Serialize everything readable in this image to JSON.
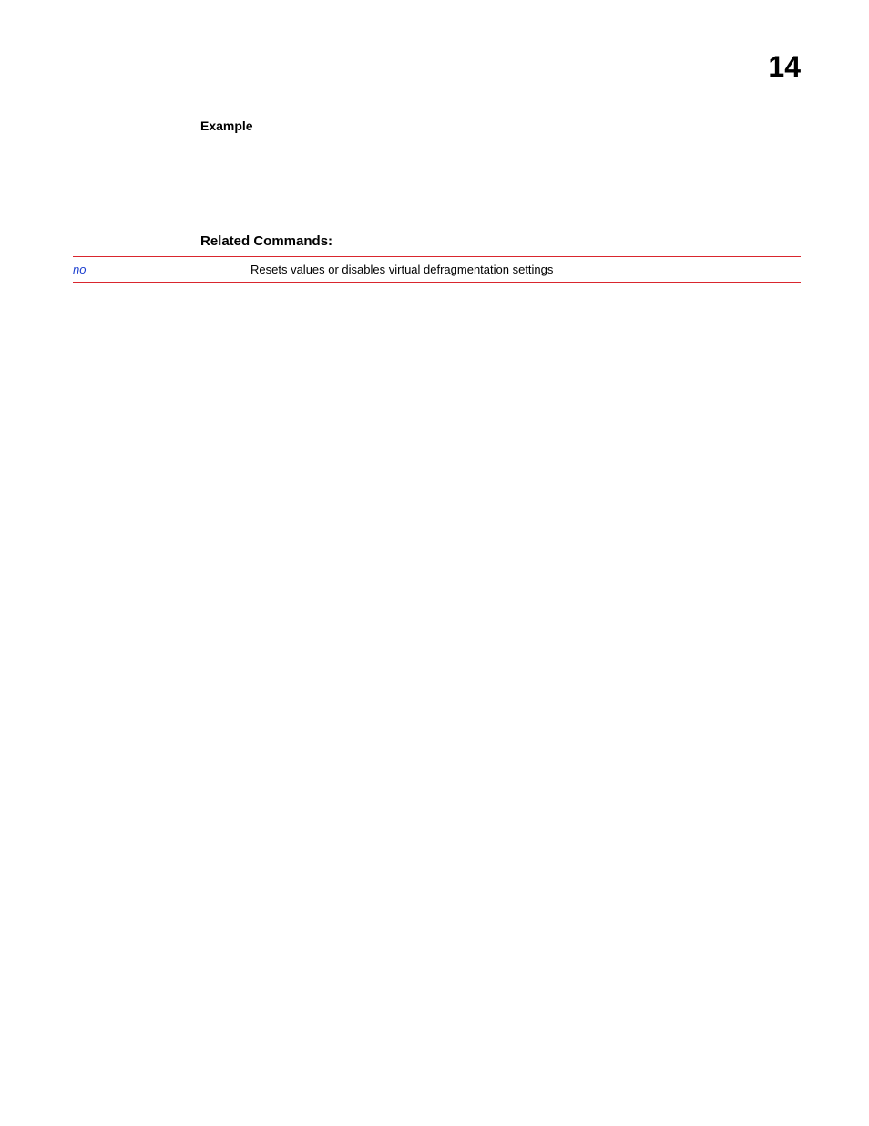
{
  "header": {
    "page_number": "14"
  },
  "sections": {
    "example_heading": "Example",
    "related_heading": "Related Commands:"
  },
  "related_commands": {
    "rows": [
      {
        "name": "no",
        "description": "Resets values or disables virtual defragmentation settings"
      }
    ]
  }
}
